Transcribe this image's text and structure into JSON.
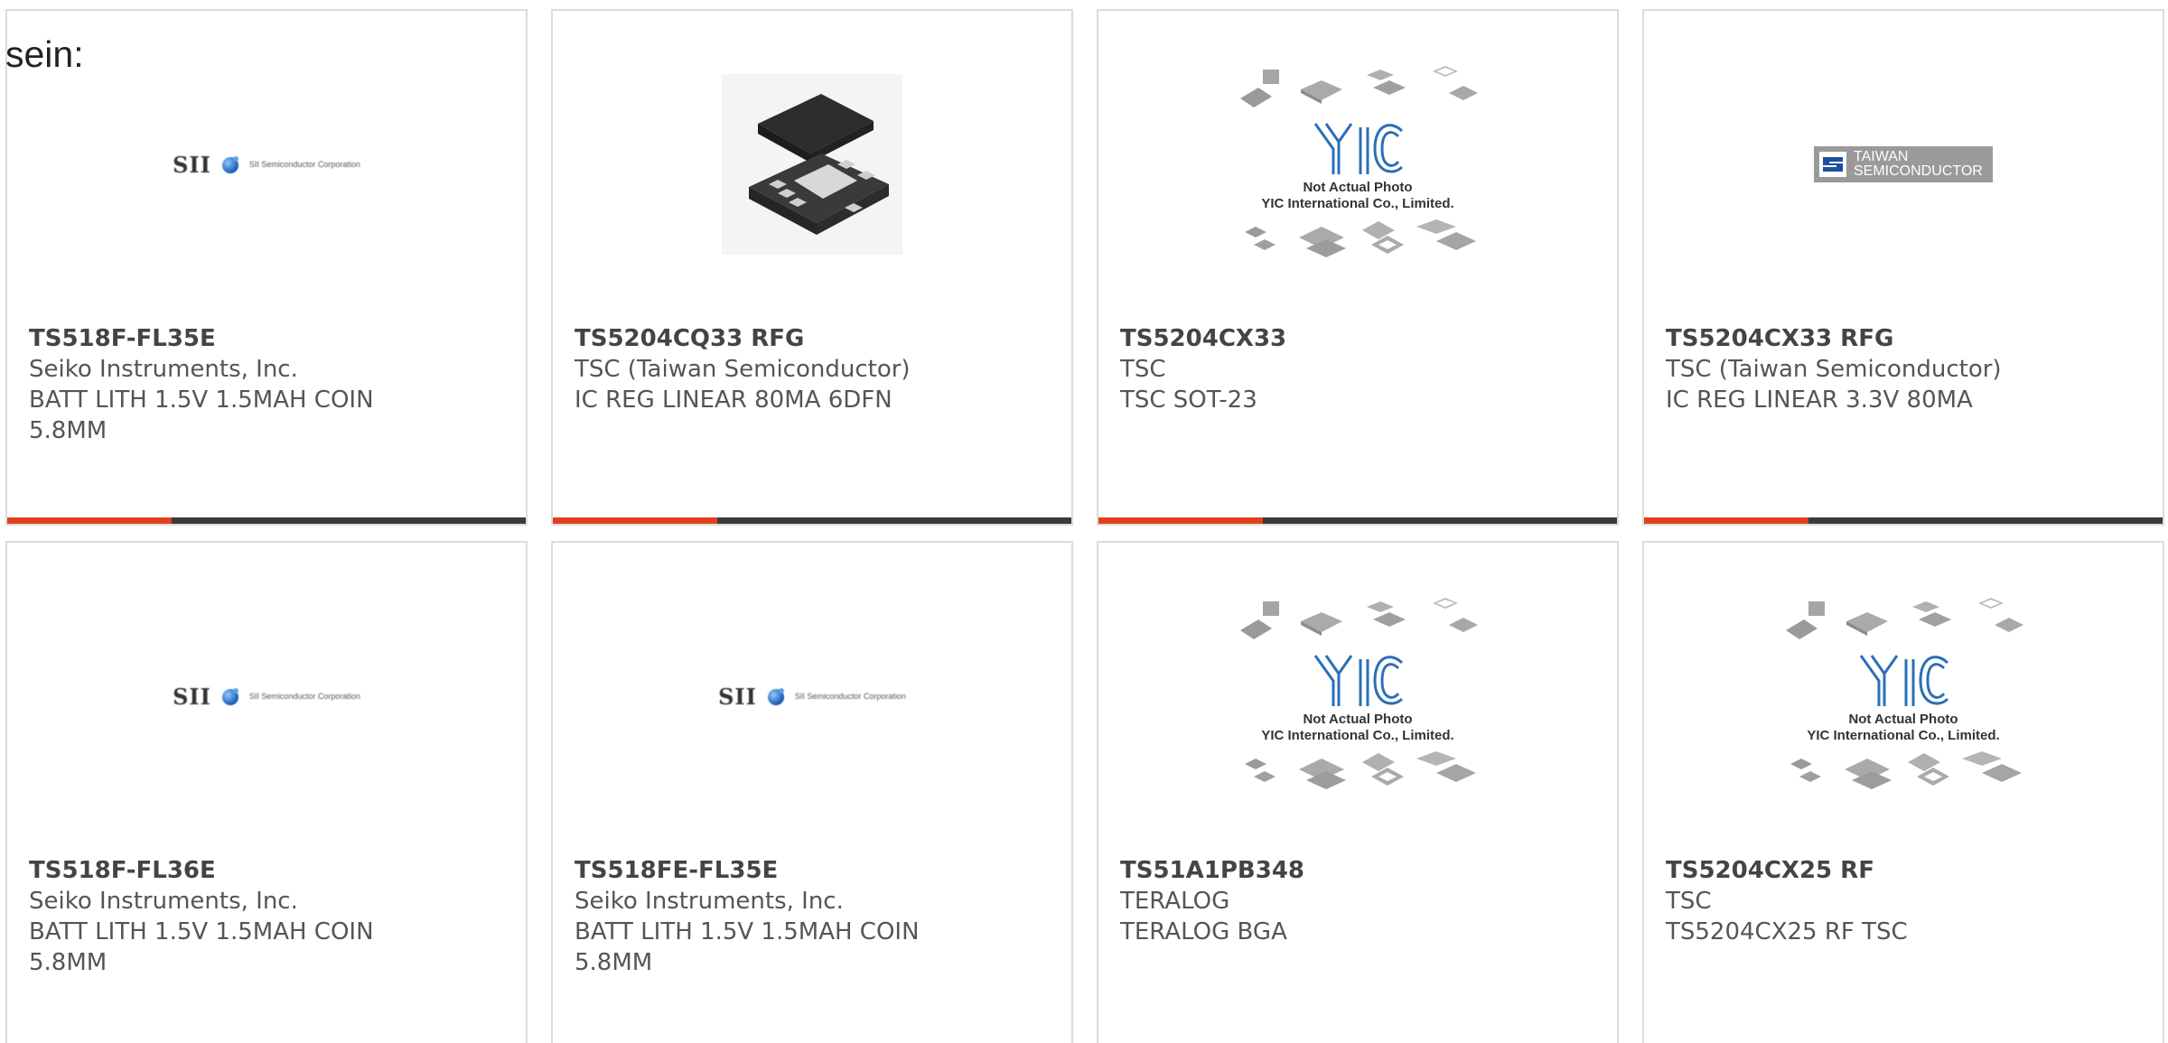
{
  "intro_text": "sein:",
  "placeholder": {
    "logo_text": "YIC",
    "line1": "Not Actual Photo",
    "line2": "YIC International Co., Limited."
  },
  "sii_logo": {
    "mark": "SII",
    "corp": "SII Semiconductor Corporation"
  },
  "tsc_logo": {
    "line1": "TAIWAN",
    "line2": "SEMICONDUCTOR"
  },
  "colors": {
    "accent": "#e2401c",
    "bar": "#3a3a3a",
    "border": "#dcdcdc"
  },
  "products": [
    {
      "part": "TS518F-FL35E",
      "maker": "Seiko Instruments, Inc.",
      "desc1": "BATT LITH 1.5V 1.5MAH COIN",
      "desc2": "5.8MM",
      "image": "sii-logo"
    },
    {
      "part": "TS5204CQ33 RFG",
      "maker": "TSC (Taiwan Semiconductor)",
      "desc1": "IC REG LINEAR 80MA 6DFN",
      "desc2": "",
      "image": "dfn-package"
    },
    {
      "part": "TS5204CX33",
      "maker": "TSC",
      "desc1": "TSC SOT-23",
      "desc2": "",
      "image": "yic-placeholder"
    },
    {
      "part": "TS5204CX33 RFG",
      "maker": "TSC (Taiwan Semiconductor)",
      "desc1": "IC REG LINEAR 3.3V 80MA",
      "desc2": "",
      "image": "tsc-logo"
    },
    {
      "part": "TS518F-FL36E",
      "maker": "Seiko Instruments, Inc.",
      "desc1": "BATT LITH 1.5V 1.5MAH COIN",
      "desc2": "5.8MM",
      "image": "sii-logo"
    },
    {
      "part": "TS518FE-FL35E",
      "maker": "Seiko Instruments, Inc.",
      "desc1": "BATT LITH 1.5V 1.5MAH COIN",
      "desc2": "5.8MM",
      "image": "sii-logo"
    },
    {
      "part": "TS51A1PB348",
      "maker": "TERALOG",
      "desc1": "TERALOG BGA",
      "desc2": "",
      "image": "yic-placeholder"
    },
    {
      "part": "TS5204CX25 RF",
      "maker": "TSC",
      "desc1": "TS5204CX25 RF TSC",
      "desc2": "",
      "image": "yic-placeholder"
    }
  ]
}
